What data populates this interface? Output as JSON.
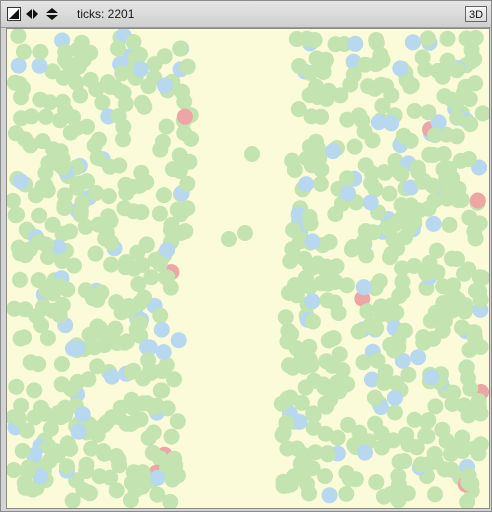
{
  "toolbar": {
    "ticks_label": "ticks: 2201",
    "three_d_label": "3D"
  },
  "world": {
    "background_color": "#fcfbd9",
    "colors": {
      "green": "#c3e3b0",
      "blue": "#b7d8ee",
      "red": "#eea5a5"
    }
  }
}
